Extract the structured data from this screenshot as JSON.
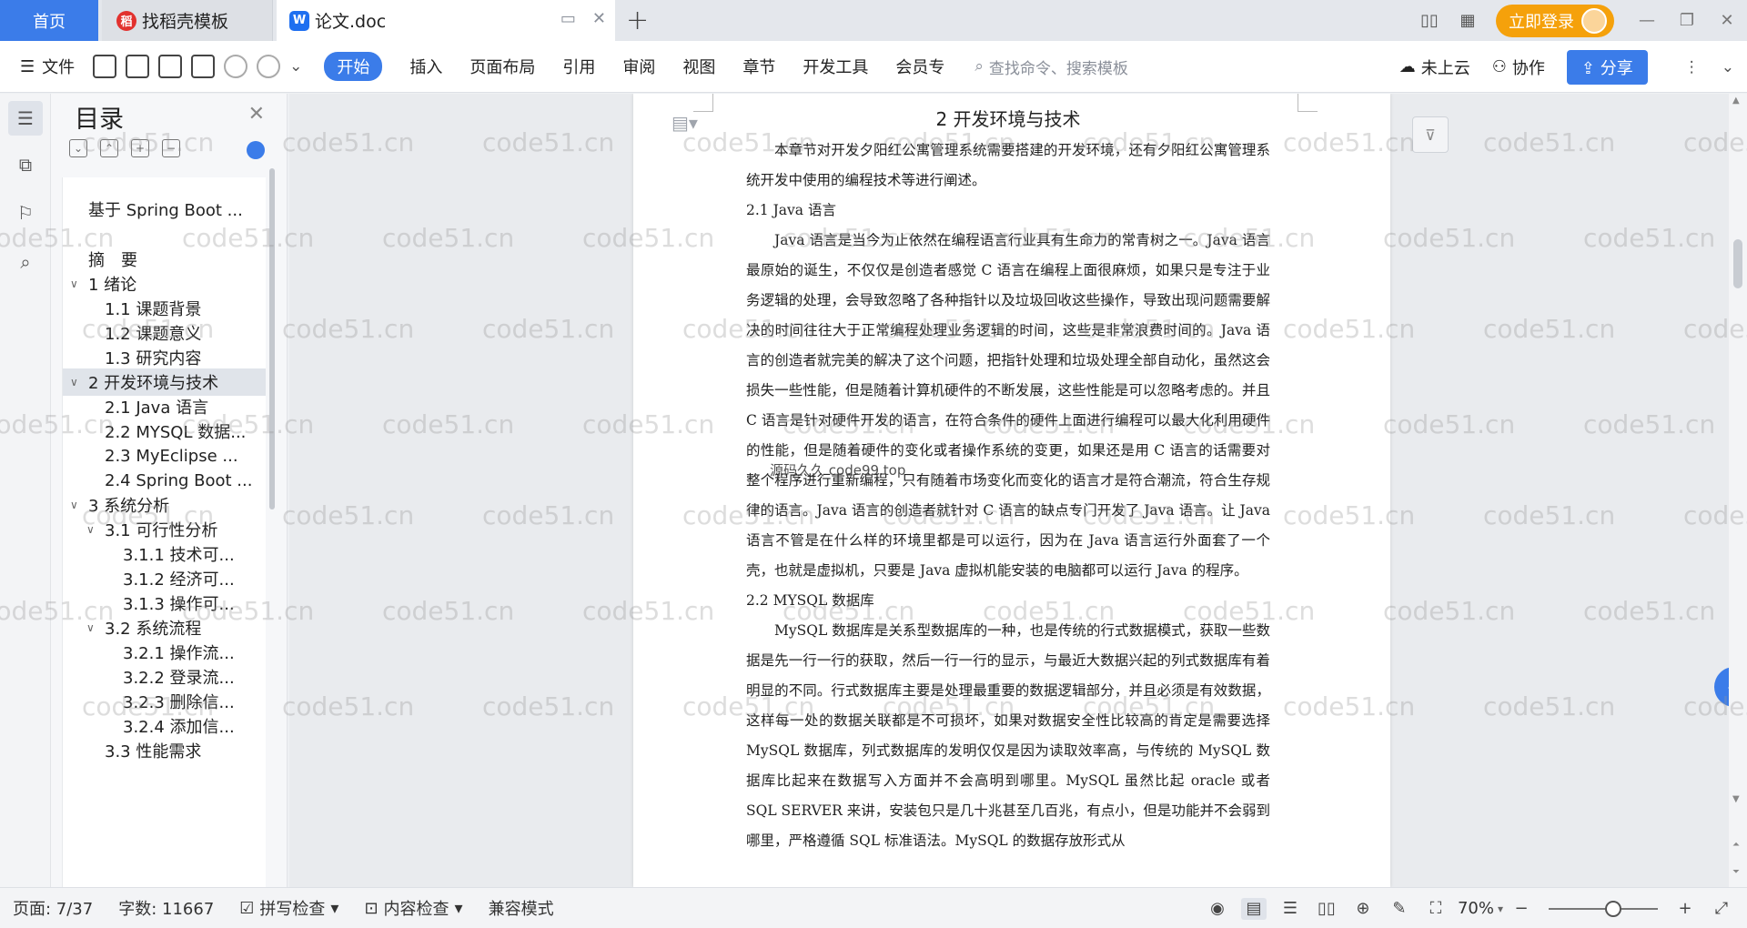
{
  "tabs": {
    "home": "首页",
    "items": [
      {
        "label": "找稻壳模板"
      },
      {
        "label": "论文.doc"
      }
    ],
    "login": "立即登录"
  },
  "ribbon": {
    "file_menu": "文件",
    "tabs": [
      "开始",
      "插入",
      "页面布局",
      "引用",
      "审阅",
      "视图",
      "章节",
      "开发工具",
      "会员专"
    ],
    "search_placeholder": "查找命令、搜索模板",
    "cloud_label": "未上云",
    "collab_label": "协作",
    "share_label": "分享"
  },
  "toc": {
    "title": "目录",
    "items": [
      {
        "text": "基于 Spring Boot ...",
        "level": 0,
        "caret": ""
      },
      {
        "text": "摘　要",
        "level": 0,
        "caret": ""
      },
      {
        "text": "1  绪论",
        "level": 0,
        "caret": "∨"
      },
      {
        "text": "1.1  课题背景",
        "level": 1,
        "caret": ""
      },
      {
        "text": "1.2  课题意义",
        "level": 1,
        "caret": ""
      },
      {
        "text": "1.3  研究内容",
        "level": 1,
        "caret": ""
      },
      {
        "text": "2  开发环境与技术",
        "level": 0,
        "caret": "∨",
        "selected": true
      },
      {
        "text": "2.1 Java 语言",
        "level": 1,
        "caret": ""
      },
      {
        "text": "2.2 MYSQL 数据...",
        "level": 1,
        "caret": ""
      },
      {
        "text": "2.3 MyEclipse ...",
        "level": 1,
        "caret": ""
      },
      {
        "text": "2.4 Spring Boot ...",
        "level": 1,
        "caret": ""
      },
      {
        "text": "3  系统分析",
        "level": 0,
        "caret": "∨"
      },
      {
        "text": "3.1  可行性分析",
        "level": 1,
        "caret": "∨"
      },
      {
        "text": "3.1.1  技术可...",
        "level": 2,
        "caret": ""
      },
      {
        "text": "3.1.2  经济可...",
        "level": 2,
        "caret": ""
      },
      {
        "text": "3.1.3  操作可...",
        "level": 2,
        "caret": ""
      },
      {
        "text": "3.2  系统流程",
        "level": 1,
        "caret": "∨"
      },
      {
        "text": "3.2.1  操作流...",
        "level": 2,
        "caret": ""
      },
      {
        "text": "3.2.2  登录流...",
        "level": 2,
        "caret": ""
      },
      {
        "text": "3.2.3  删除信...",
        "level": 2,
        "caret": ""
      },
      {
        "text": "3.2.4  添加信...",
        "level": 2,
        "caret": ""
      },
      {
        "text": "3.3  性能需求",
        "level": 1,
        "caret": ""
      }
    ]
  },
  "document": {
    "heading": "2  开发环境与技术",
    "intro": "本章节对开发夕阳红公寓管理系统需要搭建的开发环境，还有夕阳红公寓管理系统开发中使用的编程技术等进行阐述。",
    "sec1_title": "2.1 Java 语言",
    "sec1_body": "Java 语言是当今为止依然在编程语言行业具有生命力的常青树之一。Java 语言最原始的诞生，不仅仅是创造者感觉 C 语言在编程上面很麻烦，如果只是专注于业务逻辑的处理，会导致忽略了各种指针以及垃圾回收这些操作，导致出现问题需要解决的时间往往大于正常编程处理业务逻辑的时间，这些是非常浪费时间的。Java 语言的创造者就完美的解决了这个问题，把指针处理和垃圾处理全部自动化，虽然这会损失一些性能，但是随着计算机硬件的不断发展，这些性能是可以忽略考虑的。并且 C 语言是针对硬件开发的语言，在符合条件的硬件上面进行编程可以最大化利用硬件的性能，但是随着硬件的变化或者操作系统的变更，如果还是用 C 语言的话需要对整个程序进行重新编程，只有随着市场变化而变化的语言才是符合潮流，符合生存规律的语言。Java 语言的创造者就针对 C 语言的缺点专门开发了 Java 语言。让 Java 语言不管是在什么样的环境里都是可以运行，因为在 Java 语言运行外面套了一个壳，也就是虚拟机，只要是 Java 虚拟机能安装的电脑都可以运行 Java 的程序。",
    "sec2_title": "2.2 MYSQL 数据库",
    "sec2_body": "MySQL 数据库是关系型数据库的一种，也是传统的行式数据模式，获取一些数据是先一行一行的获取，然后一行一行的显示，与最近大数据兴起的列式数据库有着明显的不同。行式数据库主要是处理最重要的数据逻辑部分，并且必须是有效数据，这样每一处的数据关联都是不可损坏，如果对数据安全性比较高的肯定是需要选择 MySQL 数据库，列式数据库的发明仅仅是因为读取效率高，与传统的 MySQL 数据库比起来在数据写入方面并不会高明到哪里。MySQL 虽然比起 oracle 或者 SQL SERVER 来讲，安装包只是几十兆甚至几百兆，有点小，但是功能并不会弱到哪里，严格遵循 SQL 标准语法。MySQL 的数据存放形式从",
    "overlay": "源码久久 code99.top"
  },
  "watermark": "code51.cn",
  "status": {
    "page": "页面: 7/37",
    "words": "字数: 11667",
    "spell": "拼写检查",
    "content_check": "内容检查",
    "compat": "兼容模式",
    "zoom": "70%"
  },
  "colors": {
    "accent": "#3b7ce9",
    "login": "#f5a10b"
  }
}
